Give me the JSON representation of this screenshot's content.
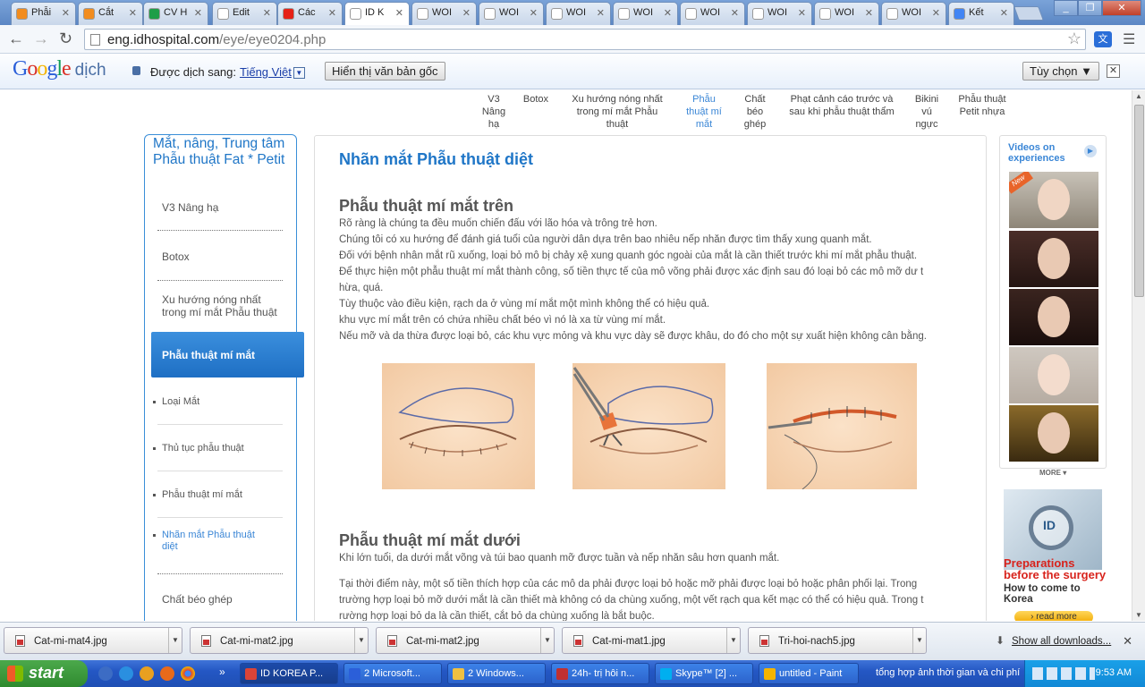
{
  "tabs": [
    {
      "label": "Phẫi",
      "color": "#f28c1e"
    },
    {
      "label": "Cắt",
      "color": "#f28c1e"
    },
    {
      "label": "CV H",
      "color": "#1e9e48"
    },
    {
      "label": "Edit",
      "color": "#ffffff"
    },
    {
      "label": "Các",
      "color": "#e62117"
    },
    {
      "label": "ID K",
      "color": "#ffffff"
    },
    {
      "label": "WOI",
      "color": "#ffffff"
    },
    {
      "label": "WOI",
      "color": "#ffffff"
    },
    {
      "label": "WOI",
      "color": "#ffffff"
    },
    {
      "label": "WOI",
      "color": "#ffffff"
    },
    {
      "label": "WOI",
      "color": "#ffffff"
    },
    {
      "label": "WOI",
      "color": "#ffffff"
    },
    {
      "label": "WOI",
      "color": "#ffffff"
    },
    {
      "label": "WOI",
      "color": "#ffffff"
    },
    {
      "label": "Kết",
      "color": "#4285f4"
    }
  ],
  "omnibox": {
    "domain": "eng.idhospital.com",
    "path": "/eye/eye0204.php"
  },
  "translate": {
    "logo_google": "Google",
    "logo_dich": "dịch",
    "translated_to": "Được dịch sang:",
    "language": "Tiếng Việt",
    "show_original": "Hiển thị văn bản gốc",
    "options": "Tùy chọn ▼",
    "close": "✕"
  },
  "topnav": [
    {
      "label": "V3 Nâng hạ"
    },
    {
      "label": "Botox"
    },
    {
      "label": "Xu hướng nóng nhất trong mí mắt Phẫu thuật"
    },
    {
      "label": "Phẫu thuật mí mắt"
    },
    {
      "label": "Chất béo ghép"
    },
    {
      "label": "Phạt cảnh cáo trước và sau khi phẫu thuật thẩm"
    },
    {
      "label": "Bikini vú ngực"
    },
    {
      "label": "Phẫu thuật Petit nhựa"
    }
  ],
  "sidebar": {
    "title": "Mắt, nâng, Trung tâm Phẫu thuật Fat * Petit",
    "items": [
      "V3 Nâng hạ",
      "Botox",
      "Xu hướng nóng nhất trong mí mắt Phẫu thuật",
      "Phẫu thuật mí mắt",
      "Chất béo ghép"
    ],
    "subitems": [
      "Loại Mắt",
      "Thủ tục phẫu thuật",
      "Phẫu thuật mí mắt",
      "Nhãn mắt Phẫu thuật diệt"
    ]
  },
  "content": {
    "title": "Nhãn mắt Phẫu thuật diệt",
    "section1": {
      "heading": "Phẫu thuật mí mắt trên",
      "lines": [
        "Rõ ràng là chúng ta đều muốn chiến đấu với lão hóa và trông trẻ hơn.",
        "Chúng tôi có xu hướng để đánh giá tuổi của người dân dựa trên bao nhiêu nếp nhăn được tìm thấy xung quanh mắt.",
        "Đối với bệnh nhân mắt rũ xuống, loại bỏ mô bị chảy xệ xung quanh góc ngoài của mắt là cần thiết trước khi mí mắt phẫu thuật.",
        "Để thực hiện một phẫu thuật mí mắt thành công, số tiền thực tế của mô võng phải được xác định sau đó loại bỏ các mô mỡ dư t",
        "hừa, quá.",
        "Tùy thuộc vào điều kiện, rạch da ở vùng mí mắt một mình không thể có hiệu quả.",
        "khu vực mí mắt trên có chứa nhiều chất béo vì nó là xa từ vùng mí mắt.",
        "Nếu mỡ và da thừa được loại bỏ, các khu vực mỏng và khu vực dày sẽ được khâu, do đó cho một sự xuất hiện không cân bằng."
      ]
    },
    "section2": {
      "heading": "Phẫu thuật mí mắt dưới",
      "p1": "Khi lớn tuổi, da dưới mắt võng và túi bao quanh mỡ được tuần và nếp nhăn sâu hơn quanh mắt.",
      "p2_lines": [
        "Tại thời điểm này, một số tiền thích hợp của các mô da phải được loại bỏ hoặc mỡ phải được loại bỏ hoặc phân phối lại. Trong",
        "trường hợp loại bỏ mỡ dưới mắt là cần thiết mà không có da chùng xuống, một vết rạch qua kết mạc có thể có hiệu quả. Trong t",
        "rường hợp loại bỏ da là cần thiết, cắt bỏ da chùng xuống là bắt buộc."
      ]
    }
  },
  "rightcol": {
    "videos_title": "Videos on experiences",
    "new_badge": "New",
    "more": "MORE ▾",
    "prep_title": "Preparations before the surgery",
    "prep_sub": "How to come to Korea",
    "read_more": "› read more",
    "prep_image_text": "ID"
  },
  "downloads": {
    "items": [
      "Cat-mi-mat4.jpg",
      "Cat-mi-mat2.jpg",
      "Cat-mi-mat2.jpg",
      "Cat-mi-mat1.jpg",
      "Tri-hoi-nach5.jpg"
    ],
    "show_all": "Show all downloads...",
    "close": "✕"
  },
  "taskbar": {
    "start": "start",
    "tasks": [
      "ID KOREA P...",
      "2 Microsoft...",
      "2 Windows...",
      "24h- trị hôi n...",
      "Skype™ [2] ...",
      "untitled - Paint"
    ],
    "tray_text": "tổng hợp ảnh thời gian và chi phí",
    "clock": "9:53 AM"
  }
}
